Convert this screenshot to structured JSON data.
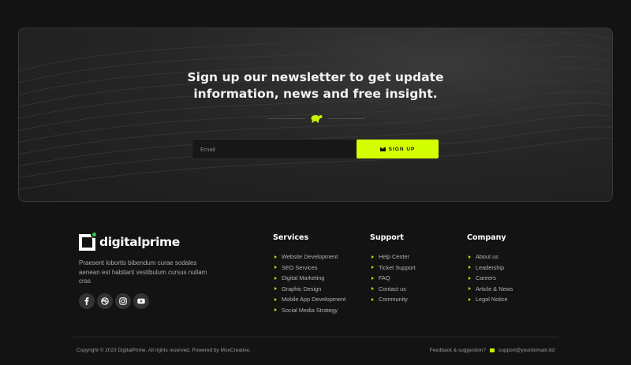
{
  "newsletter": {
    "heading_line1": "Sign up our newsletter to get update",
    "heading_line2": "information, news and free insight.",
    "email_placeholder": "Email",
    "signup_label": "SIGN UP"
  },
  "brand": {
    "name": "digitalprime",
    "description": "Praesent lobortis bibendum curae sodales aenean est habitant vestibulum cursus nullam cras"
  },
  "socials": [
    "facebook-icon",
    "dribbble-icon",
    "instagram-icon",
    "youtube-icon"
  ],
  "columns": [
    {
      "title": "Services",
      "items": [
        "Website Development",
        "SEO Services",
        "Digital Marketing",
        "Graphic Design",
        "Mobile App Development",
        "Social Media Strategy"
      ]
    },
    {
      "title": "Support",
      "items": [
        "Help Center",
        "Ticket Support",
        "FAQ",
        "Contact us",
        "Community"
      ]
    },
    {
      "title": "Company",
      "items": [
        "About us",
        "Leadership",
        "Careers",
        "Article & News",
        "Legal Notice"
      ]
    }
  ],
  "footer": {
    "copyright": "Copyright © 2023 DigitalPrime, All rights reserved. Powered by MoxCreative.",
    "feedback_label": "Feedback & suggestion?",
    "support_email": "support@yourdomain.tld"
  },
  "colors": {
    "accent": "#d4ff00",
    "background": "#131313",
    "logo_dot": "#31c84b"
  }
}
